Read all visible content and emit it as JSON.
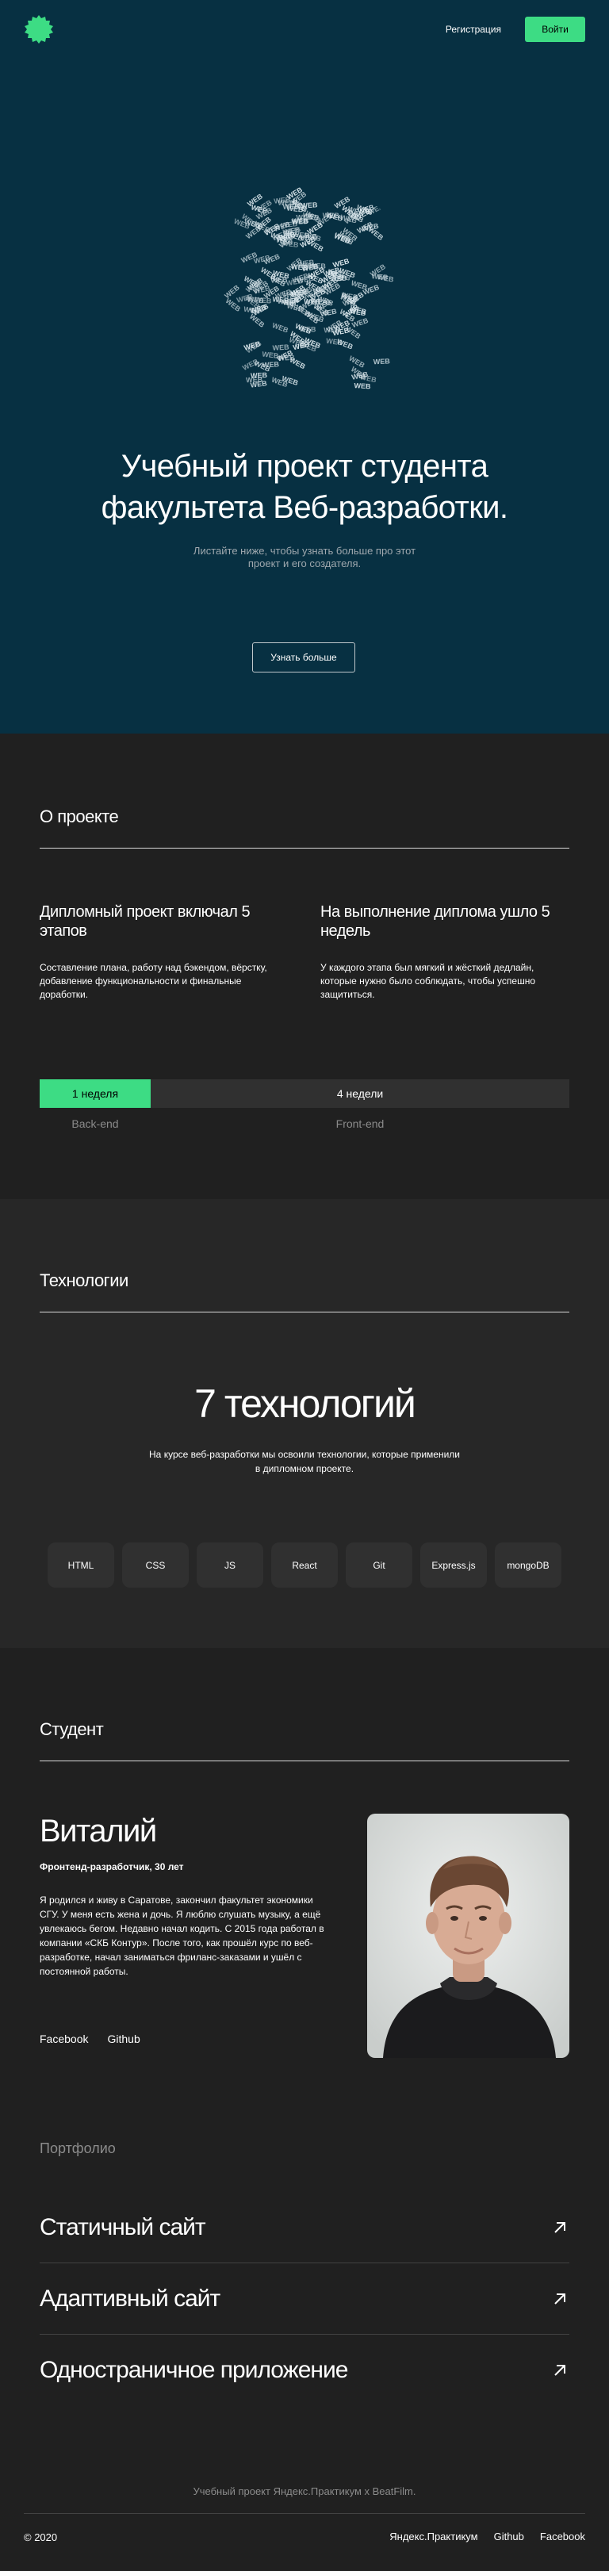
{
  "header": {
    "register_label": "Регистрация",
    "login_label": "Войти"
  },
  "hero": {
    "globe_word": "WEB",
    "title": "Учебный проект студента факультета Веб-разработки.",
    "subtitle": "Листайте ниже, чтобы узнать больше про этот проект и его создателя.",
    "more_button": "Узнать больше"
  },
  "about": {
    "title": "О проекте",
    "col1_heading": "Дипломный проект включал 5 этапов",
    "col1_text": "Составление плана, работу над бэкендом, вёрстку, добавление функциональности и финальные доработки.",
    "col2_heading": "На выполнение диплома ушло 5 недель",
    "col2_text": "У каждого этапа был мягкий и жёсткий дедлайн, которые нужно было соблюдать, чтобы успешно защититься.",
    "timeline": {
      "back_weeks": "1 неделя",
      "front_weeks": "4 недели",
      "back_label": "Back-end",
      "front_label": "Front-end"
    }
  },
  "techs": {
    "title": "Технологии",
    "big_title": "7 технологий",
    "text": "На курсе веб-разработки мы освоили технологии, которые применили в дипломном проекте.",
    "items": [
      "HTML",
      "CSS",
      "JS",
      "React",
      "Git",
      "Express.js",
      "mongoDB"
    ]
  },
  "student": {
    "title": "Студент",
    "name": "Виталий",
    "job": "Фронтенд-разработчик, 30 лет",
    "bio": "Я родился и живу в Саратове, закончил факультет экономики СГУ. У меня есть жена и дочь. Я люблю слушать музыку, а ещё увлекаюсь бегом. Недавно начал кодить. С 2015 года работал в компании «СКБ Контур». После того, как прошёл курс по веб-разработке, начал заниматься фриланс-заказами и ушёл с постоянной работы.",
    "links": [
      "Facebook",
      "Github"
    ],
    "portfolio_title": "Портфолио",
    "portfolio": [
      "Статичный сайт",
      "Адаптивный сайт",
      "Одностраничное приложение"
    ]
  },
  "footer": {
    "note": "Учебный проект Яндекс.Практикум х BeatFilm.",
    "copyright": "© 2020",
    "links": [
      "Яндекс.Практикум",
      "Github",
      "Facebook"
    ]
  },
  "colors": {
    "accent": "#3DDC84",
    "hero_bg": "#073042",
    "dark_bg": "#202020",
    "techs_bg": "#272727"
  },
  "icons": [
    "logo-icon",
    "arrow-up-right-icon"
  ]
}
